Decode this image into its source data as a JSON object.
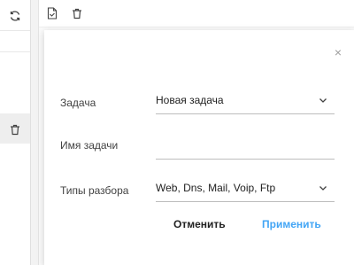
{
  "left_panel": {
    "refresh_icon": "refresh-icon",
    "trash_icon": "trash-icon"
  },
  "toolbar": {
    "icons": [
      "document-icon",
      "trash-icon"
    ]
  },
  "dialog": {
    "close_label": "×",
    "fields": {
      "task": {
        "label": "Задача",
        "value": "Новая задача"
      },
      "task_name": {
        "label": "Имя задачи",
        "value": ""
      },
      "parse_types": {
        "label": "Типы разбора",
        "value": "Web, Dns, Mail, Voip, Ftp"
      }
    },
    "buttons": {
      "cancel": "Отменить",
      "apply": "Применить"
    }
  },
  "colors": {
    "accent": "#42a5f5",
    "text": "#212121",
    "muted": "#9e9e9e"
  }
}
